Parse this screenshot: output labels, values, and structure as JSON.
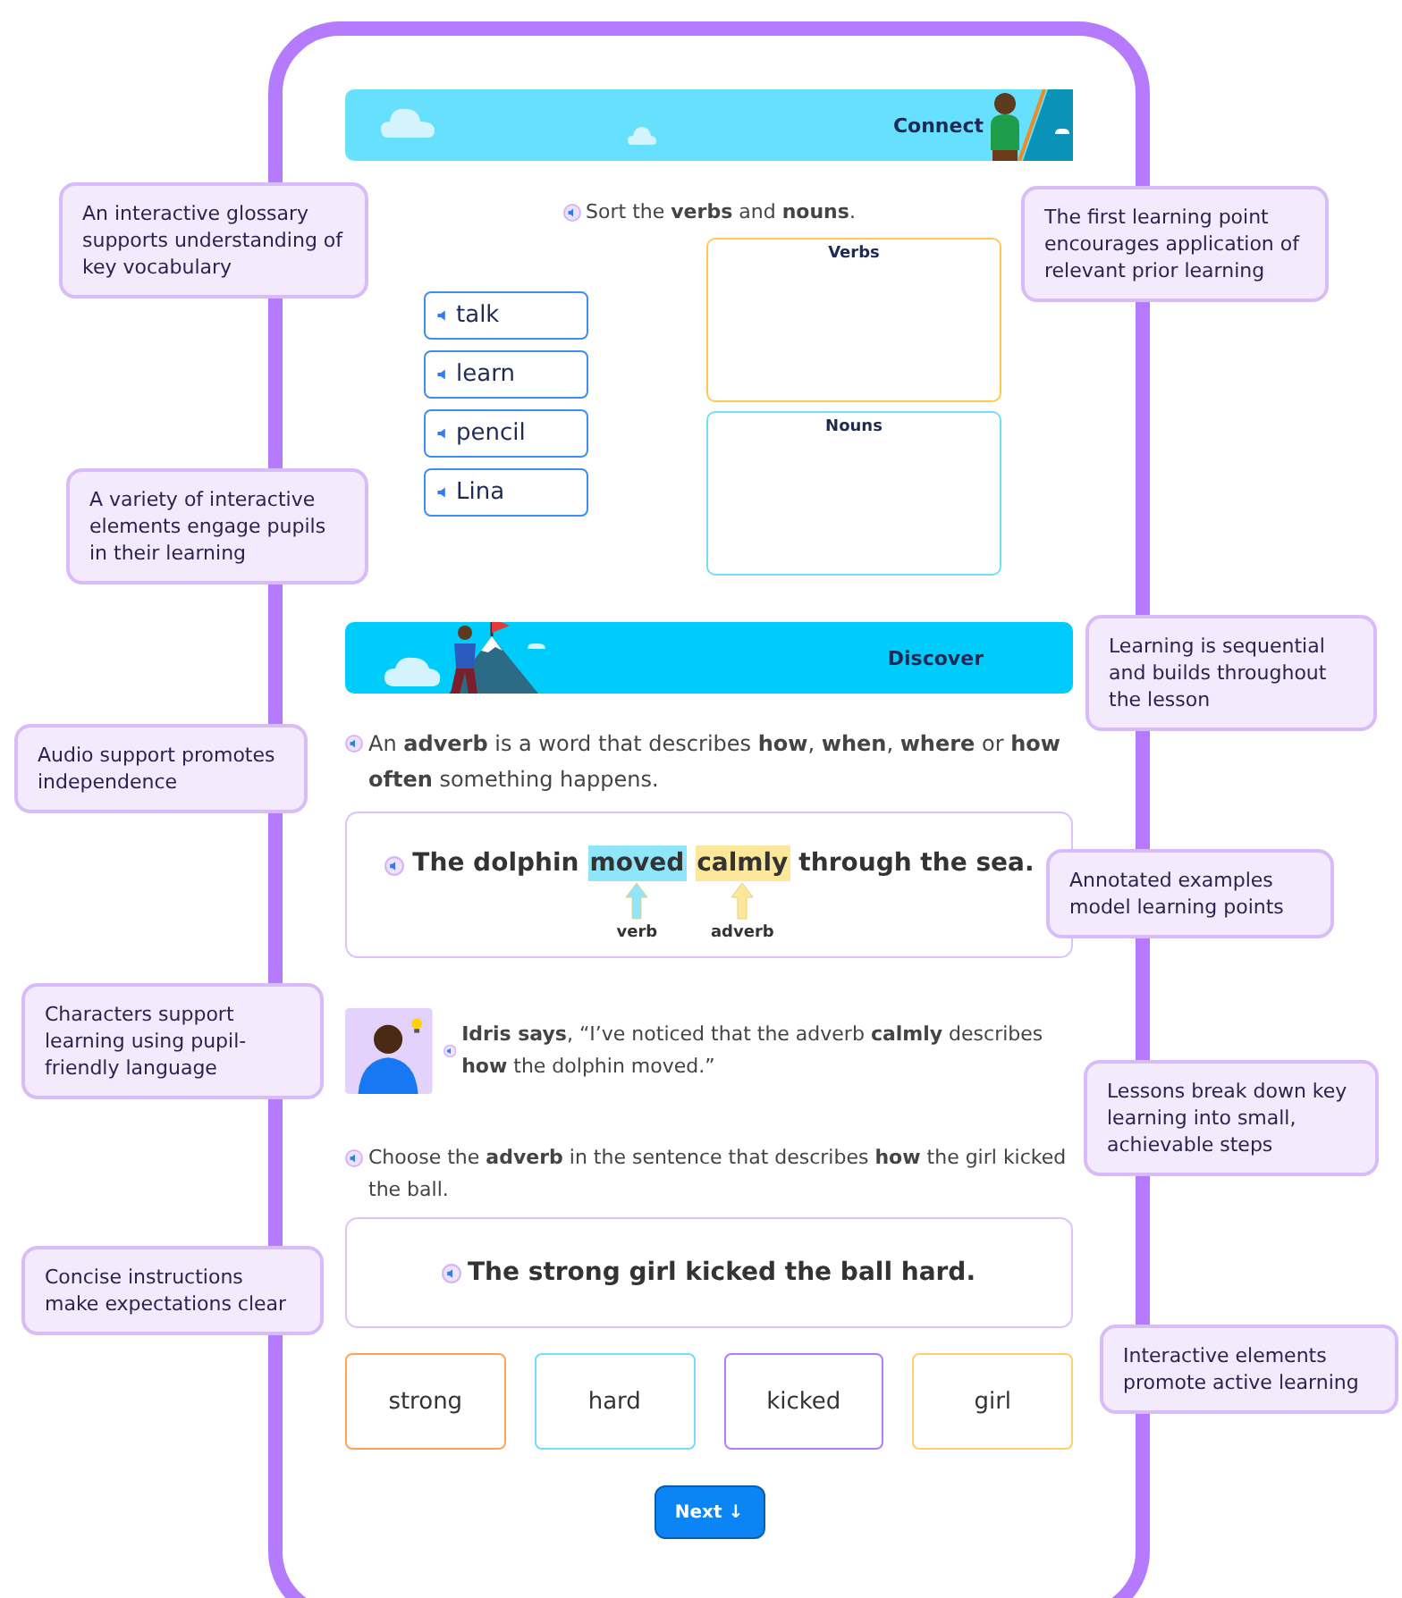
{
  "callouts_left": [
    {
      "text": "An interactive glossary supports understanding of key vocabulary"
    },
    {
      "text": "A variety of interactive elements engage pupils in their learning"
    },
    {
      "text": "Audio support promotes independence"
    },
    {
      "text": "Characters support learning using pupil-friendly language"
    },
    {
      "text": "Concise instructions make expectations clear"
    }
  ],
  "callouts_right": [
    {
      "text": "The first learning point encourages application of relevant prior learning"
    },
    {
      "text": "Learning is sequential and builds throughout the lesson"
    },
    {
      "text": "Annotated examples model learning points"
    },
    {
      "text": "Lessons break down key learning into small, achievable steps"
    },
    {
      "text": "Interactive elements promote active learning"
    }
  ],
  "connect": {
    "title": "Connect",
    "instruction": "Sort the **verbs** and **nouns**.",
    "words": [
      "talk",
      "learn",
      "pencil",
      "Lina"
    ],
    "bins": [
      {
        "label": "Verbs",
        "color": "#ffc94d"
      },
      {
        "label": "Nouns",
        "color": "#6fe0f7"
      }
    ]
  },
  "discover": {
    "title": "Discover",
    "definition": "An **adverb** is a word that describes **how**, **when**, **where** or **how often** something happens.",
    "example": [
      {
        "kind": "plain",
        "text": "The dolphin"
      },
      {
        "kind": "highlight",
        "text": "moved",
        "color": "#8fe6fb",
        "label": "verb"
      },
      {
        "kind": "highlight",
        "text": "calmly",
        "color": "#fde79a",
        "label": "adverb"
      },
      {
        "kind": "plain",
        "text": "through the sea."
      }
    ],
    "speech": "**Idris says**, “I’ve noticed that the adverb **calmly** describes **how** the dolphin moved.”"
  },
  "question": {
    "instruction": "Choose the **adverb** in the sentence that describes **how** the girl kicked the ball.",
    "sentence": "The strong girl kicked the ball hard.",
    "options": [
      {
        "label": "strong",
        "color": "#ffa552"
      },
      {
        "label": "hard",
        "color": "#6fe0f7"
      },
      {
        "label": "kicked",
        "color": "#b57bff"
      },
      {
        "label": "girl",
        "color": "#ffd06b"
      }
    ]
  },
  "next_button": "Next ↓"
}
